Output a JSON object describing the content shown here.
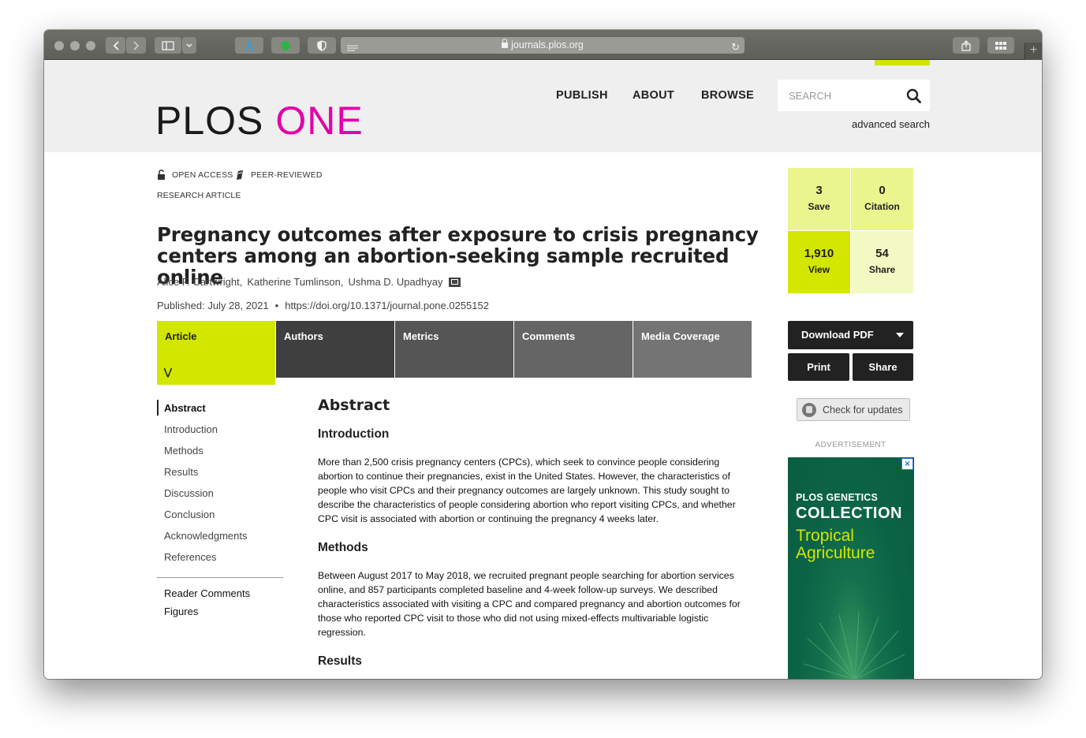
{
  "browser": {
    "url": "journals.plos.org"
  },
  "header": {
    "logo_plos": "PLOS",
    "logo_one": "ONE",
    "nav": [
      "PUBLISH",
      "ABOUT",
      "BROWSE"
    ],
    "search_placeholder": "SEARCH",
    "advanced_search": "advanced search"
  },
  "article": {
    "flags": [
      "OPEN ACCESS",
      "PEER-REVIEWED"
    ],
    "type": "RESEARCH ARTICLE",
    "title": "Pregnancy outcomes after exposure to crisis pregnancy centers among an abortion-seeking sample recruited online",
    "authors": [
      "Alice F. Cartwright,",
      "Katherine Tumlinson,",
      "Ushma D. Upadhyay"
    ],
    "published": "Published: July 28, 2021",
    "doi": "https://doi.org/10.1371/journal.pone.0255152"
  },
  "tabs": [
    {
      "label": "Article",
      "active": true,
      "color": "#d3e600"
    },
    {
      "label": "Authors",
      "active": false,
      "color": "#3f3f3f"
    },
    {
      "label": "Metrics",
      "active": false,
      "color": "#555555"
    },
    {
      "label": "Comments",
      "active": false,
      "color": "#656565"
    },
    {
      "label": "Media Coverage",
      "active": false,
      "color": "#747474"
    }
  ],
  "left_nav": {
    "items": [
      "Abstract",
      "Introduction",
      "Methods",
      "Results",
      "Discussion",
      "Conclusion",
      "Acknowledgments",
      "References"
    ],
    "active": "Abstract",
    "extra": [
      "Reader Comments",
      "Figures"
    ]
  },
  "abstract": {
    "heading": "Abstract",
    "sections": [
      {
        "title": "Introduction",
        "text": "More than 2,500 crisis pregnancy centers (CPCs), which seek to convince people considering abortion to continue their pregnancies, exist in the United States. However, the characteristics of people who visit CPCs and their pregnancy outcomes are largely unknown. This study sought to describe the characteristics of people considering abortion who report visiting CPCs, and whether CPC visit is associated with abortion or continuing the pregnancy 4 weeks later."
      },
      {
        "title": "Methods",
        "text": "Between August 2017 to May 2018, we recruited pregnant people searching for abortion services online, and 857 participants completed baseline and 4-week follow-up surveys. We described characteristics associated with visiting a CPC and compared pregnancy and abortion outcomes for those who reported CPC visit to those who did not using mixed-effects multivariable logistic regression."
      },
      {
        "title": "Results",
        "text": ""
      }
    ]
  },
  "metrics": [
    {
      "value": "3",
      "label": "Save",
      "color": "#eaf58e"
    },
    {
      "value": "0",
      "label": "Citation",
      "color": "#eaf58e"
    },
    {
      "value": "1,910",
      "label": "View",
      "color": "#d3e600"
    },
    {
      "value": "54",
      "label": "Share",
      "color": "#f3f9c3"
    }
  ],
  "actions": {
    "download": "Download PDF",
    "print": "Print",
    "share": "Share",
    "check_updates": "Check for updates"
  },
  "ad": {
    "label": "ADVERTISEMENT",
    "pre": "PLOS GENETICS",
    "title": "COLLECTION",
    "subtitle": "Tropical Agriculture"
  },
  "colors": {
    "accent": "#d3e600",
    "logo_one": "#e100a9"
  }
}
